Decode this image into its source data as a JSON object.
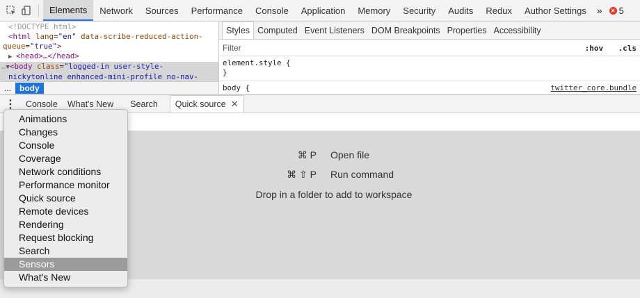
{
  "toolbar": {
    "tabs": [
      "Elements",
      "Network",
      "Sources",
      "Performance",
      "Console",
      "Application",
      "Memory",
      "Security",
      "Audits",
      "Redux",
      "Author Settings"
    ],
    "more": "»",
    "error_count": "5"
  },
  "dom": {
    "doctype": "<!DOCTYPE html>",
    "html_tag": "<html",
    "html_attr1": "lang",
    "html_val1": "\"en\"",
    "html_attr2": "data-scribe-reduced-action-",
    "html_attr2b": "queue",
    "html_val2": "\"true\"",
    "head": "<head>…</head>",
    "body_tag": "<body",
    "body_attr": "class",
    "body_val1": "\"logged-in user-style-",
    "body_val2": "nickytonline enhanced-mini-profile no-nav-",
    "breadcrumb_dots": "...",
    "breadcrumb_body": "body"
  },
  "styles": {
    "tabs": [
      "Styles",
      "Computed",
      "Event Listeners",
      "DOM Breakpoints",
      "Properties",
      "Accessibility"
    ],
    "filter_label": "Filter",
    "hov": ":hov",
    "cls": ".cls",
    "element_style": "element.style {",
    "close_brace": "}",
    "body_selector": "body {",
    "body_source": "twitter_core.bundle"
  },
  "drawer": {
    "tabs": [
      "Console",
      "What's New",
      "Search"
    ],
    "active_tab": "Quick source",
    "shortcuts": [
      {
        "keys": "⌘ P",
        "label": "Open file"
      },
      {
        "keys": "⌘ ⇧ P",
        "label": "Run command"
      }
    ],
    "drop_hint": "Drop in a folder to add to workspace"
  },
  "menu": {
    "items": [
      "Animations",
      "Changes",
      "Console",
      "Coverage",
      "Network conditions",
      "Performance monitor",
      "Quick source",
      "Remote devices",
      "Rendering",
      "Request blocking",
      "Search",
      "Sensors",
      "What's New"
    ],
    "highlighted": "Sensors"
  }
}
